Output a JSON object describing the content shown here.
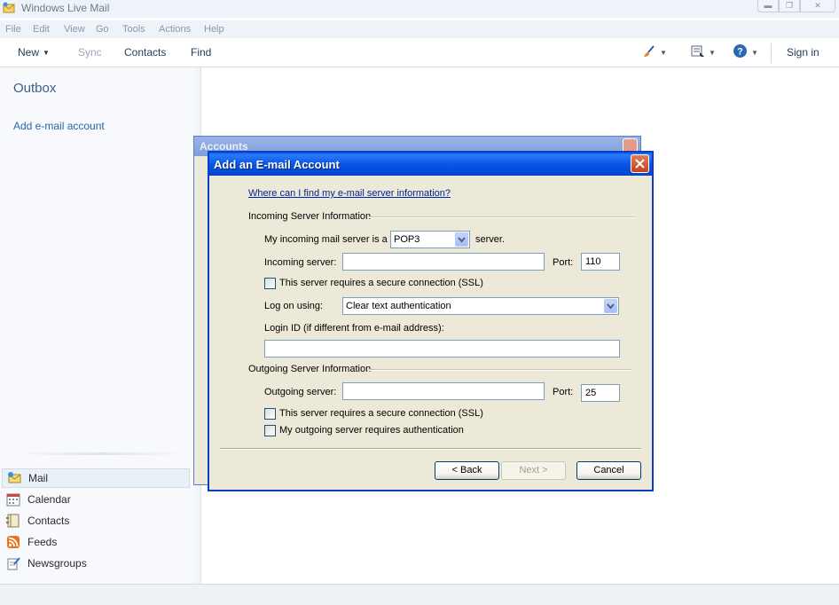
{
  "window": {
    "title": "Windows Live Mail",
    "controls": [
      "minimize",
      "restore",
      "close"
    ]
  },
  "menu": [
    "File",
    "Edit",
    "View",
    "Go",
    "Tools",
    "Actions",
    "Help"
  ],
  "toolbar": {
    "new_label": "New",
    "sync_label": "Sync",
    "contacts_label": "Contacts",
    "find_label": "Find",
    "sign_in_label": "Sign in",
    "icons": [
      "paintbrush-icon",
      "layout-icon",
      "help-icon"
    ]
  },
  "sidebar": {
    "folder_title": "Outbox",
    "add_account_label": "Add e-mail account",
    "nav_items": [
      {
        "label": "Mail",
        "icon": "mail-icon",
        "selected": true
      },
      {
        "label": "Calendar",
        "icon": "calendar-icon",
        "selected": false
      },
      {
        "label": "Contacts",
        "icon": "contacts-icon",
        "selected": false
      },
      {
        "label": "Feeds",
        "icon": "feeds-icon",
        "selected": false
      },
      {
        "label": "Newsgroups",
        "icon": "newsgroups-icon",
        "selected": false
      }
    ]
  },
  "accounts_dialog": {
    "title": "Accounts"
  },
  "dialog": {
    "title": "Add an E-mail Account",
    "help_link": "Where can I find my e-mail server information?",
    "incoming_group": "Incoming Server Information",
    "server_type_prefix": "My incoming mail server is a",
    "server_type_value": "POP3",
    "server_type_suffix": "server.",
    "incoming_server_label": "Incoming server:",
    "incoming_server_value": "",
    "incoming_port_label": "Port:",
    "incoming_port_value": "110",
    "incoming_ssl_label": "This server requires a secure connection (SSL)",
    "incoming_ssl_checked": false,
    "logon_label": "Log on using:",
    "logon_value": "Clear text authentication",
    "login_id_label": "Login ID (if different from e-mail address):",
    "login_id_value": "",
    "outgoing_group": "Outgoing Server Information",
    "outgoing_server_label": "Outgoing server:",
    "outgoing_server_value": "",
    "outgoing_port_label": "Port:",
    "outgoing_port_value": "25",
    "outgoing_ssl_label": "This server requires a secure connection (SSL)",
    "outgoing_ssl_checked": false,
    "outgoing_auth_label": "My outgoing server requires authentication",
    "outgoing_auth_checked": false,
    "back_label": "< Back",
    "next_label": "Next >",
    "cancel_label": "Cancel"
  }
}
